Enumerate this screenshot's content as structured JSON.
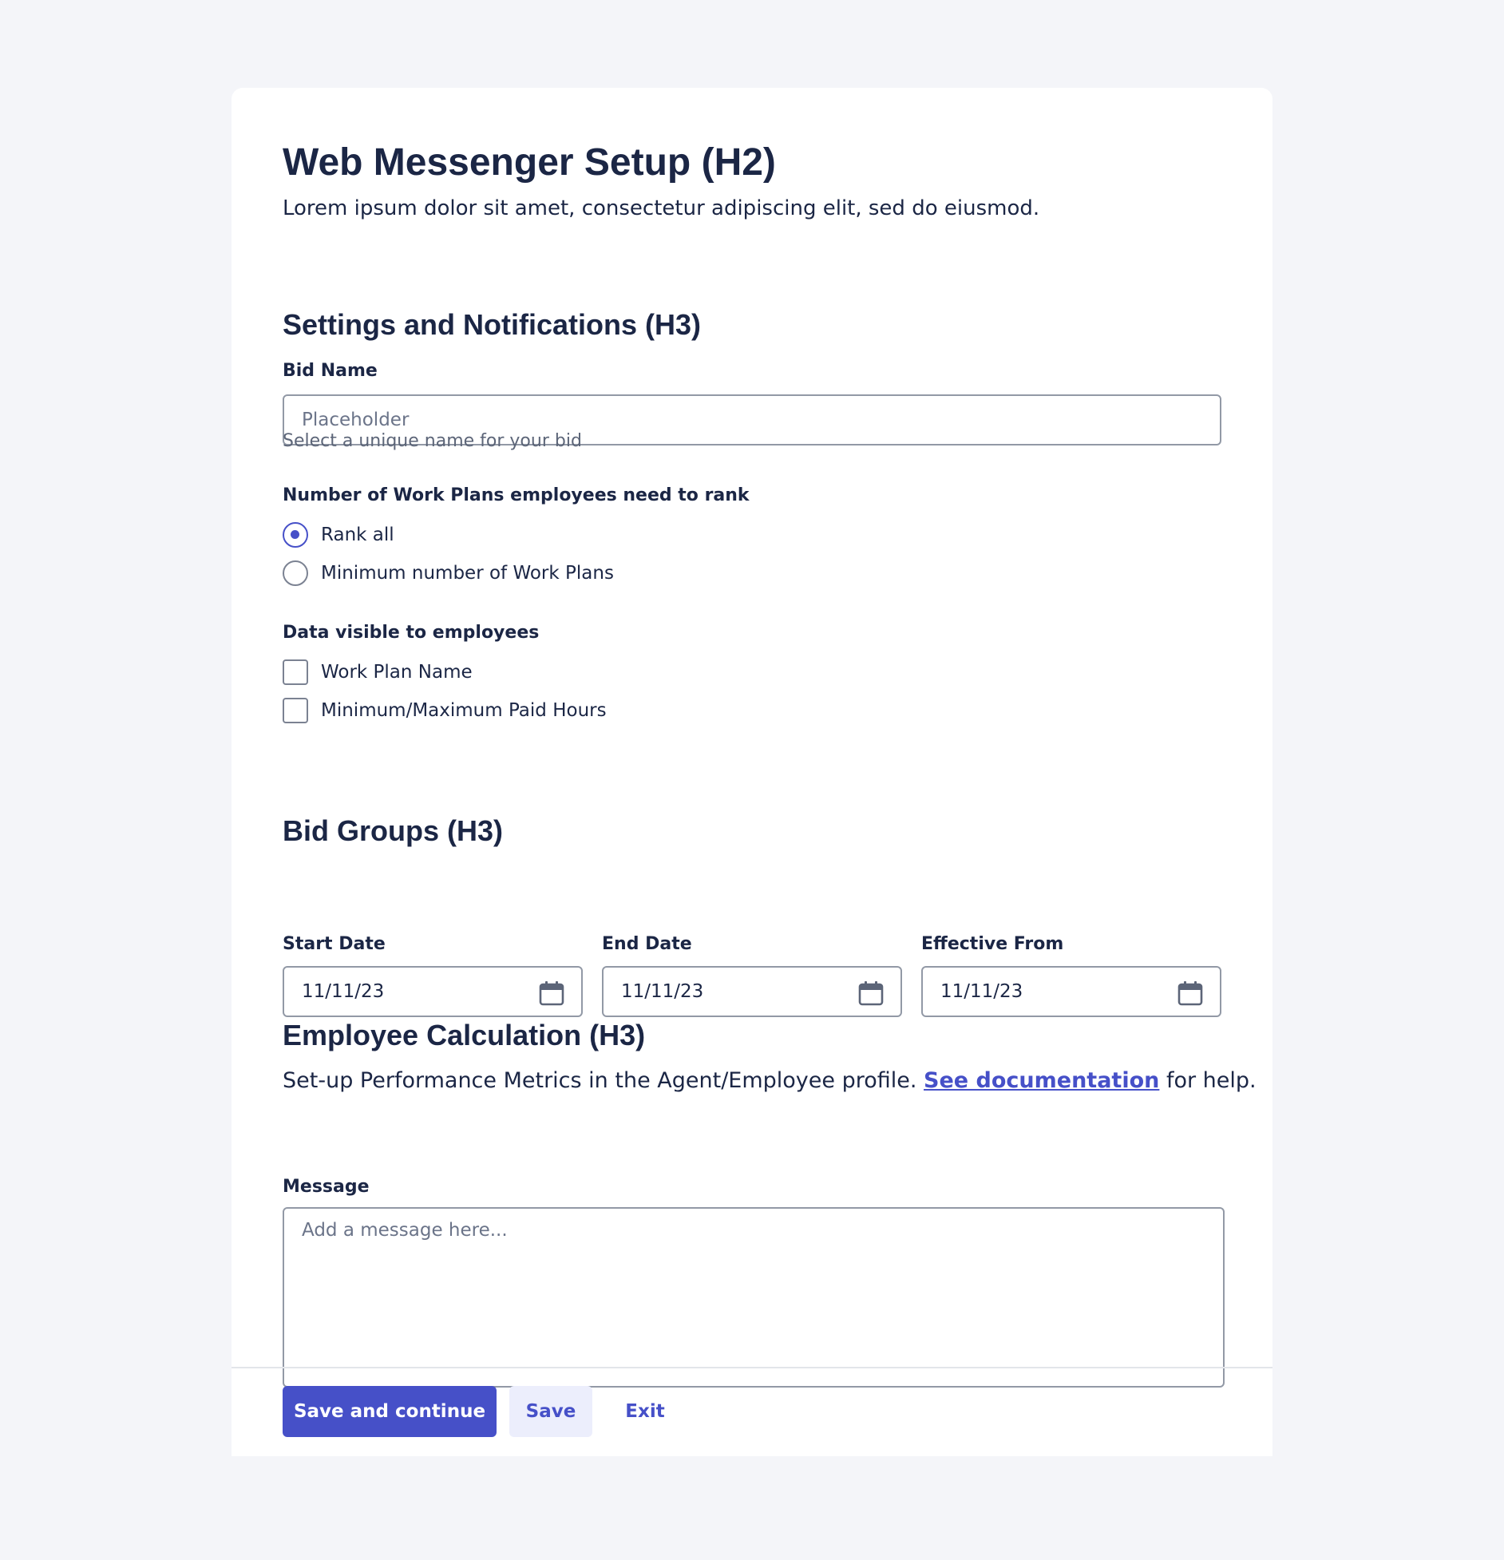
{
  "page": {
    "title": "Web Messenger Setup (H2)",
    "subtitle": "Lorem ipsum dolor sit amet, consectetur adipiscing elit, sed do eiusmod."
  },
  "settings": {
    "heading": "Settings and Notifications (H3)",
    "bid_name": {
      "label": "Bid Name",
      "value": "",
      "placeholder": "Placeholder",
      "helper": "Select a unique name for your bid"
    },
    "rank": {
      "label": "Number of Work Plans employees need to rank",
      "options": [
        {
          "label": "Rank all",
          "checked": true
        },
        {
          "label": "Minimum number of Work Plans",
          "checked": false
        }
      ]
    },
    "visible_data": {
      "label": "Data visible to employees",
      "options": [
        {
          "label": "Work Plan Name",
          "checked": false
        },
        {
          "label": "Minimum/Maximum Paid Hours",
          "checked": false
        }
      ]
    }
  },
  "bid_groups": {
    "heading": "Bid Groups (H3)",
    "fields": [
      {
        "label": "Start Date",
        "value": "11/11/23",
        "icon": "calendar-icon"
      },
      {
        "label": "End Date",
        "value": "11/11/23",
        "icon": "calendar-icon"
      },
      {
        "label": "Effective From",
        "value": "11/11/23",
        "icon": "calendar-icon"
      }
    ]
  },
  "employee_calc": {
    "heading": "Employee Calculation (H3)",
    "text_before": "Set-up Performance Metrics in the Agent/Employee profile. ",
    "link": "See documentation",
    "text_after": " for help.",
    "message": {
      "label": "Message",
      "value": "",
      "placeholder": "Add a message here..."
    }
  },
  "footer": {
    "primary": "Save and continue",
    "secondary": "Save",
    "tertiary": "Exit"
  },
  "colors": {
    "accent": "#4650c8",
    "text": "#1b2645",
    "background": "#f4f5f9"
  }
}
